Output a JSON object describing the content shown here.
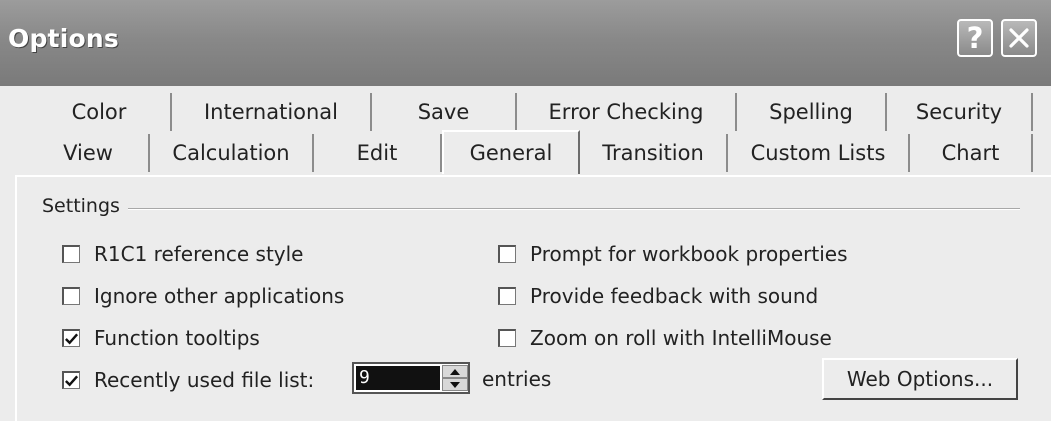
{
  "window": {
    "title": "Options",
    "help_label": "?"
  },
  "tabs_row1": [
    "Color",
    "International",
    "Save",
    "Error Checking",
    "Spelling",
    "Security"
  ],
  "tabs_row2": [
    "View",
    "Calculation",
    "Edit",
    "General",
    "Transition",
    "Custom Lists",
    "Chart"
  ],
  "active_tab": "General",
  "settings": {
    "legend": "Settings",
    "options": [
      {
        "label": "R1C1 reference style",
        "checked": false
      },
      {
        "label": "Ignore other applications",
        "checked": false
      },
      {
        "label": "Function tooltips",
        "checked": true
      },
      {
        "label": "Recently used file list:",
        "checked": true
      },
      {
        "label": "Prompt for workbook properties",
        "checked": false
      },
      {
        "label": "Provide feedback with sound",
        "checked": false
      },
      {
        "label": "Zoom on roll with IntelliMouse",
        "checked": false
      }
    ],
    "recent_files_value": "9",
    "entries_label": "entries",
    "web_options_label": "Web Options..."
  },
  "colors": {
    "titlebar": "#888888",
    "dialog_bg": "#ececec"
  }
}
